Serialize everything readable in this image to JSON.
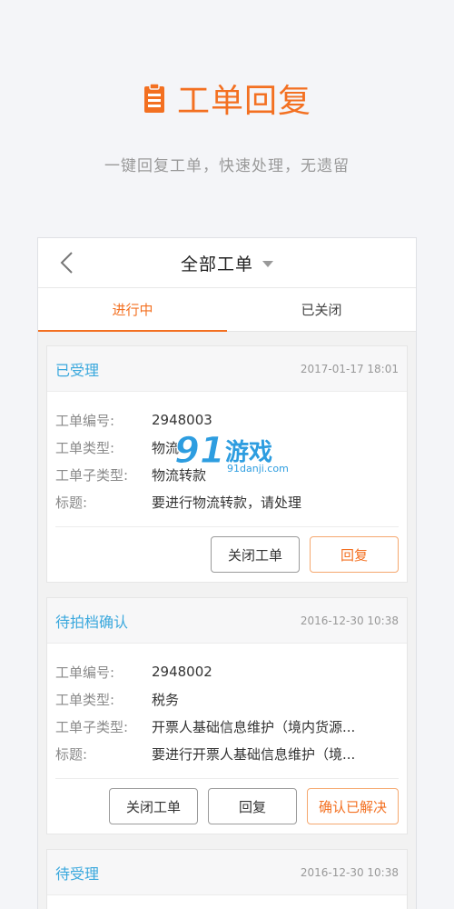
{
  "hero": {
    "title": "工单回复",
    "subtitle": "一键回复工单，快速处理，无遗留",
    "accent_color": "#f37021",
    "icon": "clipboard-icon"
  },
  "topbar": {
    "title": "全部工单",
    "back_icon": "chevron-left-icon",
    "dropdown_icon": "caret-down-icon"
  },
  "tabs": [
    {
      "label": "进行中",
      "active": true
    },
    {
      "label": "已关闭",
      "active": false
    }
  ],
  "labels": {
    "number": "工单编号:",
    "type": "工单类型:",
    "subtype": "工单子类型:",
    "title": "标题:"
  },
  "cards": [
    {
      "status": "已受理",
      "time": "2017-01-17 18:01",
      "number": "2948003",
      "type": "物流",
      "subtype": "物流转款",
      "title": "要进行物流转款，请处理",
      "buttons": [
        "关闭工单",
        "回复"
      ]
    },
    {
      "status": "待拍档确认",
      "time": "2016-12-30 10:38",
      "number": "2948002",
      "type": "税务",
      "subtype": "开票人基础信息维护（境内货源...",
      "title": "要进行开票人基础信息维护（境...",
      "buttons": [
        "关闭工单",
        "回复",
        "确认已解决"
      ]
    },
    {
      "status": "待受理",
      "time": "2016-12-30 10:38"
    }
  ],
  "watermark": {
    "logo": "91",
    "name": "游戏",
    "site": "91danji.com"
  }
}
